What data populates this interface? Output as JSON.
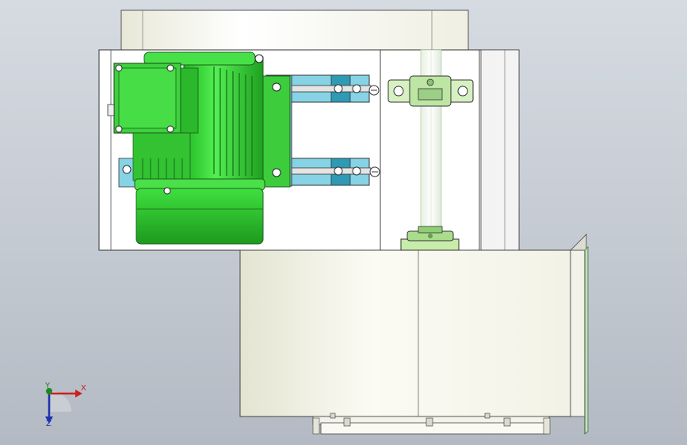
{
  "viewport": {
    "background_top": "#d6dbe2",
    "background_bottom": "#b4bac3"
  },
  "triad": {
    "x_label": "X",
    "y_label": "Y",
    "z_label": "Z",
    "x_color": "#cc2020",
    "y_color": "#1a8a1a",
    "z_color": "#2030b0"
  },
  "model": {
    "motor_color": "#2fd12f",
    "bracket_color": "#7ecfe4",
    "panel_color": "#ffffff",
    "housing_color": "#f4f4ea",
    "icons": [
      "motor-icon",
      "pillow-block-bearing-icon",
      "shaft-coupling-icon",
      "bolt-icon"
    ]
  }
}
